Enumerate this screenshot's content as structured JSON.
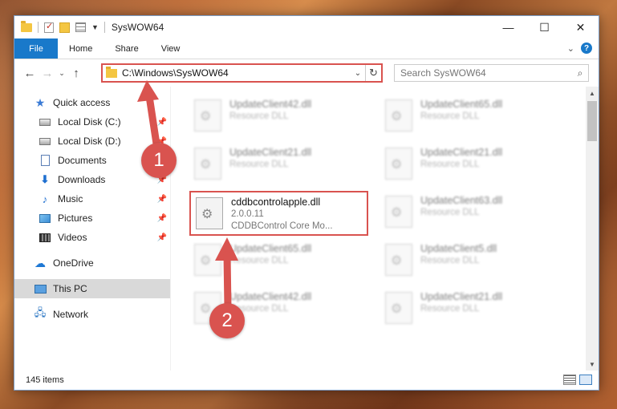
{
  "window": {
    "title": "SysWOW64",
    "controls": {
      "minimize": "—",
      "maximize": "☐",
      "close": "✕"
    }
  },
  "ribbon": {
    "tabs": [
      "File",
      "Home",
      "Share",
      "View"
    ],
    "help": "?",
    "expand": "⌄"
  },
  "nav": {
    "back": "←",
    "forward": "→",
    "recent": "⌄",
    "up": "↑",
    "address": "C:\\Windows\\SysWOW64",
    "address_drop": "⌄",
    "refresh": "↻",
    "search_placeholder": "Search SysWOW64",
    "search_icon": "⌕"
  },
  "sidebar": {
    "quick_access": "Quick access",
    "items": [
      {
        "label": "Local Disk (C:)",
        "icon": "disk-icon"
      },
      {
        "label": "Local Disk (D:)",
        "icon": "disk-icon"
      },
      {
        "label": "Documents",
        "icon": "documents-icon"
      },
      {
        "label": "Downloads",
        "icon": "downloads-icon"
      },
      {
        "label": "Music",
        "icon": "music-icon"
      },
      {
        "label": "Pictures",
        "icon": "pictures-icon"
      },
      {
        "label": "Videos",
        "icon": "videos-icon"
      }
    ],
    "onedrive": "OneDrive",
    "thispc": "This PC",
    "network": "Network",
    "pin": "📌"
  },
  "files": {
    "left": [
      {
        "name": "UpdateClient42.dll",
        "desc": "Resource DLL"
      },
      {
        "name": "UpdateClient21.dll",
        "desc": "Resource DLL"
      },
      {
        "name": "UpdateClient65.dll",
        "desc": "Resource DLL"
      },
      {
        "name": "UpdateClient42.dll",
        "desc": "Resource DLL"
      }
    ],
    "focus": {
      "name": "cddbcontrolapple.dll",
      "version": "2.0.0.11",
      "desc": "CDDBControl Core Mo..."
    },
    "right": [
      {
        "name": "UpdateClient65.dll",
        "desc": "Resource DLL"
      },
      {
        "name": "UpdateClient21.dll",
        "desc": "Resource DLL"
      },
      {
        "name": "UpdateClient63.dll",
        "desc": "Resource DLL"
      },
      {
        "name": "UpdateClient5.dll",
        "desc": "Resource DLL"
      },
      {
        "name": "UpdateClient21.dll",
        "desc": "Resource DLL"
      }
    ]
  },
  "status": {
    "count": "145 items"
  },
  "annotations": {
    "step1": "1",
    "step2": "2",
    "color": "#d9534f"
  }
}
